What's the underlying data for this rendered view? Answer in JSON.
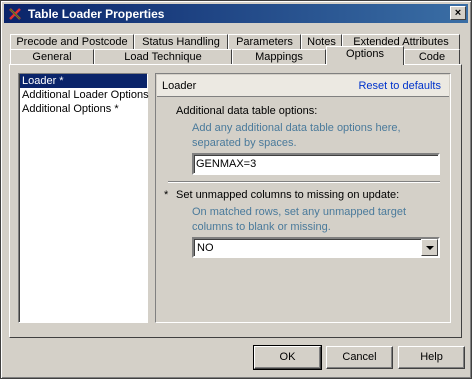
{
  "window": {
    "title": "Table Loader Properties",
    "close_label": "×"
  },
  "tabs_back": [
    "Precode and Postcode",
    "Status Handling",
    "Parameters",
    "Notes",
    "Extended Attributes"
  ],
  "tabs_front": [
    "General",
    "Load Technique",
    "Mappings",
    "Options",
    "Code"
  ],
  "active_tab": "Options",
  "left_list": [
    {
      "label": "Loader *",
      "selected": true
    },
    {
      "label": "Additional Loader Options",
      "selected": false
    },
    {
      "label": "Additional Options *",
      "selected": false
    }
  ],
  "panel": {
    "title": "Loader",
    "reset_label": "Reset to defaults",
    "additional_options_label": "Additional data table options:",
    "additional_options_hint": "Add any additional data table options here, separated by spaces.",
    "additional_options_value": "GENMAX=3",
    "required_marker": "*",
    "unmapped_label": "Set unmapped columns to missing on update:",
    "unmapped_hint": "On matched rows, set any unmapped target columns to blank or missing.",
    "unmapped_value": "NO"
  },
  "buttons": {
    "ok": "OK",
    "cancel": "Cancel",
    "help": "Help"
  },
  "colors": {
    "title_start": "#0a246a",
    "title_end": "#3a6ea5",
    "selection": "#0a246a",
    "link": "#0033cc",
    "hint": "#4a7a9b"
  }
}
